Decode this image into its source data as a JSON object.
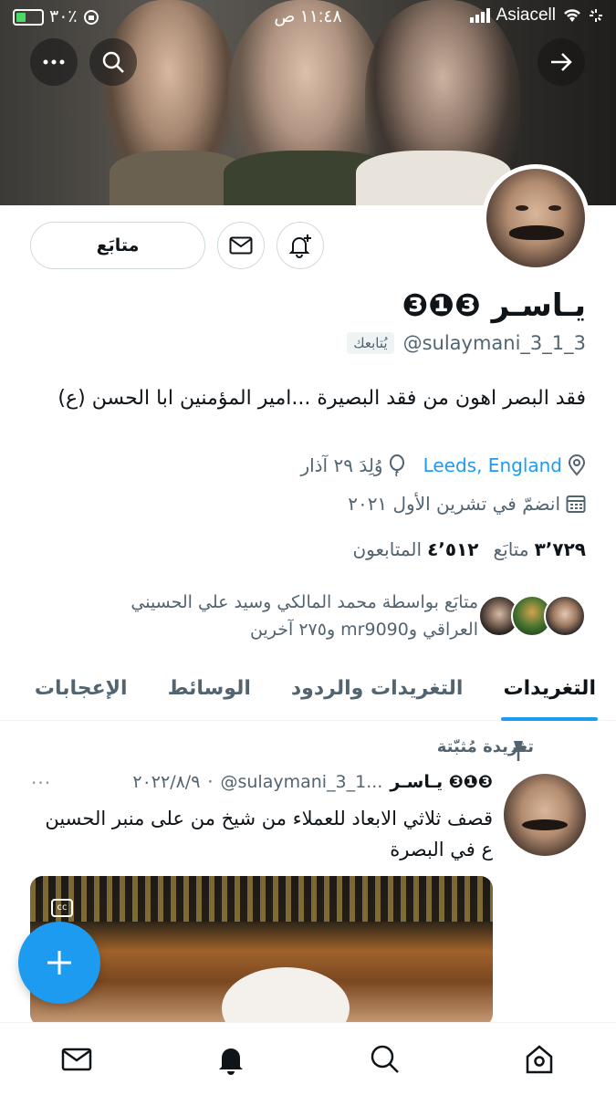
{
  "status_bar": {
    "battery": "٣٠٪",
    "time": "١١:٤٨ ص",
    "carrier": "Asiacell"
  },
  "profile": {
    "name": "يـاسـر ❸❶❸",
    "handle": "@sulaymani_3_1_3",
    "follows_you": "يُتابعك",
    "bio": "فقد البصر اهون من فقد البصيرة ...امير المؤمنين ابا الحسن (ع)",
    "location": "Leeds, England",
    "birthday": "وُلِدَ ٢٩ آذار",
    "joined": "انضمّ في تشرين الأول ٢٠٢١",
    "following_count": "٣٬٧٢٩",
    "following_label": "متابَع",
    "followers_count": "٤٬٥١٢",
    "followers_label": "المتابعون",
    "followed_by": "متابَع بواسطة محمد المالكي وسيد علي الحسيني العراقي وmr9090 و٢٧٥ آخرين",
    "follow_button": "متابَع"
  },
  "tabs": [
    {
      "label": "التغريدات",
      "active": true
    },
    {
      "label": "التغريدات والردود",
      "active": false
    },
    {
      "label": "الوسائط",
      "active": false
    },
    {
      "label": "الإعجابات",
      "active": false
    }
  ],
  "tweet": {
    "pinned_label": "تغريدة مُثبّتة",
    "author_name": "يـاسـر ❸❶❸",
    "author_handle": "@sulaymani_3_1...",
    "date": "٢٠٢٢/٨/٩",
    "separator": "·",
    "more": "···",
    "text": "قصف ثلاثي الابعاد للعملاء من شيخ من على منبر الحسين ع في البصرة"
  },
  "colors": {
    "accent": "#1d9bf0",
    "text_primary": "#0f1419",
    "text_secondary": "#536471"
  },
  "icons": {
    "more": "more-icon",
    "search": "search-icon",
    "forward": "arrow-right-icon",
    "message": "mail-icon",
    "notify": "bell-plus-icon",
    "location": "location-pin-icon",
    "birthday": "balloon-icon",
    "calendar": "calendar-icon",
    "pin": "pin-icon",
    "fab": "plus-icon"
  }
}
